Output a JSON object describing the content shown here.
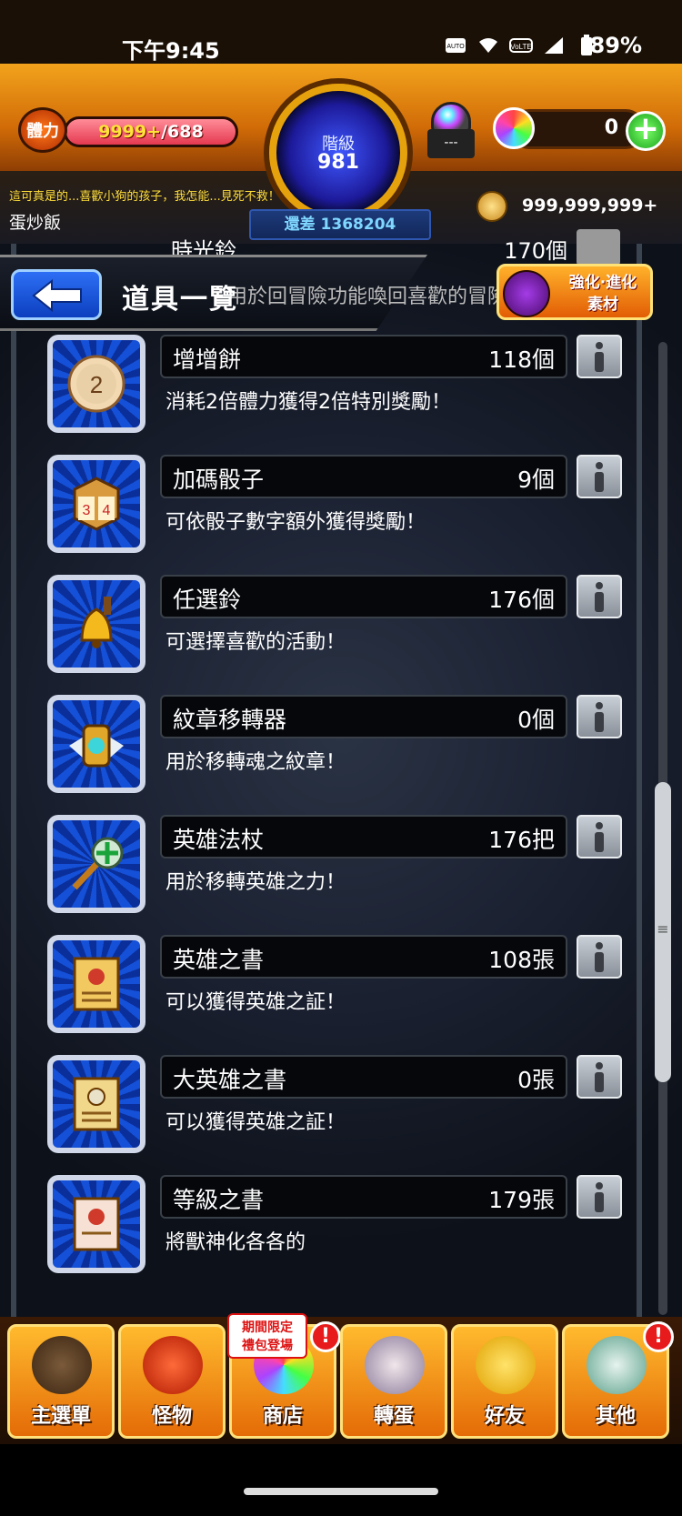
{
  "status_bar": {
    "time": "下午9:45",
    "battery": "89%",
    "icons": [
      "auto-hz-icon",
      "wifi-icon",
      "volte-icon",
      "signal-icon",
      "battery-icon"
    ]
  },
  "hud": {
    "stamina_label": "體力",
    "stamina_current": "9999+",
    "stamina_max": "/688",
    "stamina_fill_fraction": 1.0,
    "rank_label": "階級",
    "rank_value": "981",
    "rank_remaining": "還差 1368204",
    "gacha_box_label": "---",
    "orb_count": "0",
    "orb_plus": "+",
    "chat_line": "這可真是的...喜歡小狗的孩子，我怎能...見死不救！",
    "player_name": "蛋炒飯",
    "gold_count": "999,999,999+"
  },
  "header": {
    "page_title": "道具一覽",
    "evolve_button_line1": "強化",
    "evolve_button_line2": "進化",
    "evolve_button_line3": "素材"
  },
  "ghost_item": {
    "name": "時光鈴",
    "count": "170個",
    "desc": "用於回冒險功能喚回喜歡的冒險"
  },
  "items": [
    {
      "name": "增增餅",
      "count": "118個",
      "desc": "消耗2倍體力獲得2倍特別獎勵！",
      "icon": "cookie-icon"
    },
    {
      "name": "加碼骰子",
      "count": "9個",
      "desc": "可依骰子數字額外獲得獎勵！",
      "icon": "dice-icon"
    },
    {
      "name": "任選鈴",
      "count": "176個",
      "desc": "可選擇喜歡的活動！",
      "icon": "bell-icon"
    },
    {
      "name": "紋章移轉器",
      "count": "0個",
      "desc": "用於移轉魂之紋章！",
      "icon": "emblem-transfer-icon"
    },
    {
      "name": "英雄法杖",
      "count": "176把",
      "desc": "用於移轉英雄之力！",
      "icon": "hero-staff-icon"
    },
    {
      "name": "英雄之書",
      "count": "108張",
      "desc": "可以獲得英雄之証！",
      "icon": "hero-scroll-icon"
    },
    {
      "name": "大英雄之書",
      "count": "0張",
      "desc": "可以獲得英雄之証！",
      "icon": "great-hero-scroll-icon"
    },
    {
      "name": "等級之書",
      "count": "179張",
      "desc": "將獸神化各各的",
      "icon": "level-scroll-icon"
    }
  ],
  "bottom_nav": {
    "items": [
      {
        "label": "主選單",
        "icon": "home-icon",
        "alert": ""
      },
      {
        "label": "怪物",
        "icon": "monster-icon",
        "alert": ""
      },
      {
        "label": "商店",
        "icon": "shop-orb-icon",
        "alert": "!"
      },
      {
        "label": "轉蛋",
        "icon": "gacha-icon",
        "alert": ""
      },
      {
        "label": "好友",
        "icon": "friends-icon",
        "alert": ""
      },
      {
        "label": "其他",
        "icon": "other-icon",
        "alert": "!"
      }
    ],
    "promo_line1": "期間限定",
    "promo_line2": "禮包登場"
  },
  "colors": {
    "hud_orange": "#e8830e",
    "rank_blue": "#1d1a9a",
    "stamina_pink": "#e53950",
    "nav_orange": "#f19a1a"
  }
}
